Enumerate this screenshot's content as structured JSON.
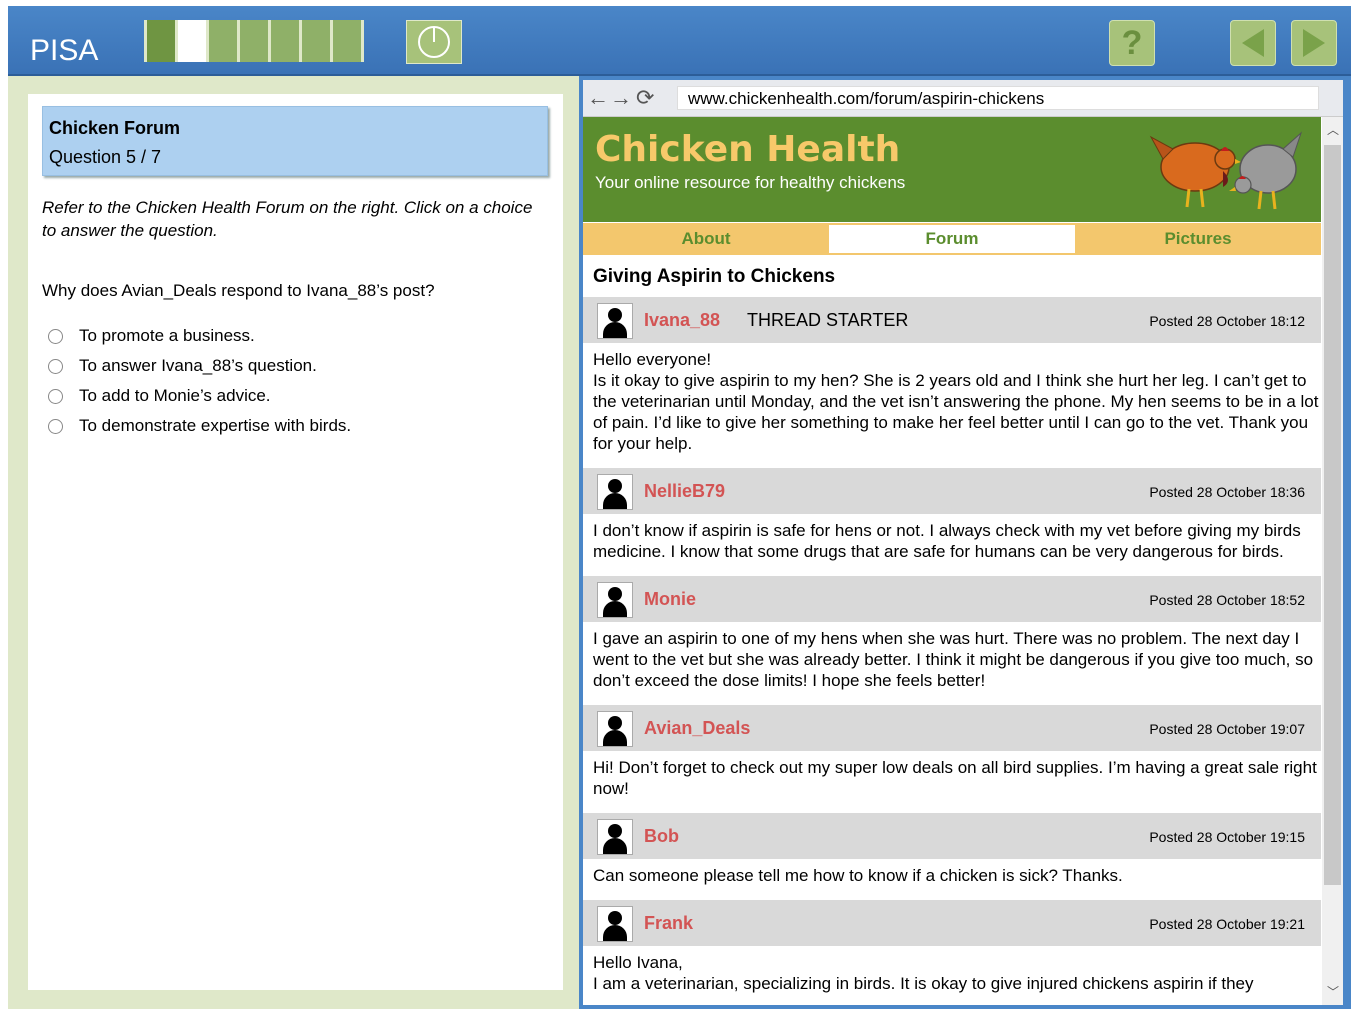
{
  "app": {
    "logo": "PISA"
  },
  "progress": {
    "total": 7,
    "current": 2
  },
  "toolbar": {
    "help_label": "?"
  },
  "left": {
    "unit_title": "Chicken Forum",
    "question_number": "Question 5 / 7",
    "instructions": "Refer to the Chicken Health Forum on the right. Click on a choice to answer the question.",
    "question": "Why does Avian_Deals respond to Ivana_88’s post?",
    "options": [
      "To promote a business.",
      "To answer Ivana_88’s question.",
      "To add to Monie’s advice.",
      "To demonstrate expertise with birds."
    ]
  },
  "browser": {
    "url": "www.chickenhealth.com/forum/aspirin-chickens",
    "nav_back": "←",
    "nav_forward": "→",
    "nav_reload": "⟳"
  },
  "site": {
    "title": "Chicken Health",
    "subtitle": "Your online resource for healthy chickens",
    "tabs": [
      "About",
      "Forum",
      "Pictures"
    ],
    "active_tab": "Forum",
    "thread_title": "Giving Aspirin to Chickens",
    "starter_label": "THREAD STARTER",
    "posts": [
      {
        "user": "Ivana_88",
        "posted": "Posted 28 October 18:12",
        "body": [
          "Hello everyone!",
          "Is it okay to give aspirin to my hen? She is 2 years old and I think she hurt her leg. I can’t get to the veterinarian until Monday, and the vet isn’t answering the phone. My hen seems to be in a lot of pain. I’d like to give her something to make her feel better until I can go to the vet. Thank you for your help."
        ]
      },
      {
        "user": "NellieB79",
        "posted": "Posted 28 October 18:36",
        "body": [
          "I don’t know if aspirin is safe for hens or not. I always check with my vet before giving my birds medicine. I know that some drugs that are safe for humans can be very dangerous for birds."
        ]
      },
      {
        "user": "Monie",
        "posted": "Posted 28 October 18:52",
        "body": [
          "I gave an aspirin to one of my hens when she was hurt. There was no problem. The next day I went to the vet but she was already better. I think it might be dangerous if you give too much, so don’t exceed the dose limits! I hope she feels better!"
        ]
      },
      {
        "user": "Avian_Deals",
        "posted": "Posted 28 October 19:07",
        "body": [
          "Hi! Don’t forget to check out my super low deals on all bird supplies. I’m having a great sale right now!"
        ]
      },
      {
        "user": "Bob",
        "posted": "Posted 28 October 19:15",
        "body": [
          "Can someone please tell me how to know if a chicken is sick? Thanks."
        ]
      },
      {
        "user": "Frank",
        "posted": "Posted 28 October 19:21",
        "body": [
          "Hello Ivana,",
          "I am a veterinarian, specializing in birds. It is okay to give injured chickens aspirin if they"
        ]
      }
    ]
  },
  "colors": {
    "accent_blue": "#4a86c8",
    "header_green": "#5b8d2e",
    "nav_yellow": "#f3c76d",
    "username_red": "#d35454"
  }
}
